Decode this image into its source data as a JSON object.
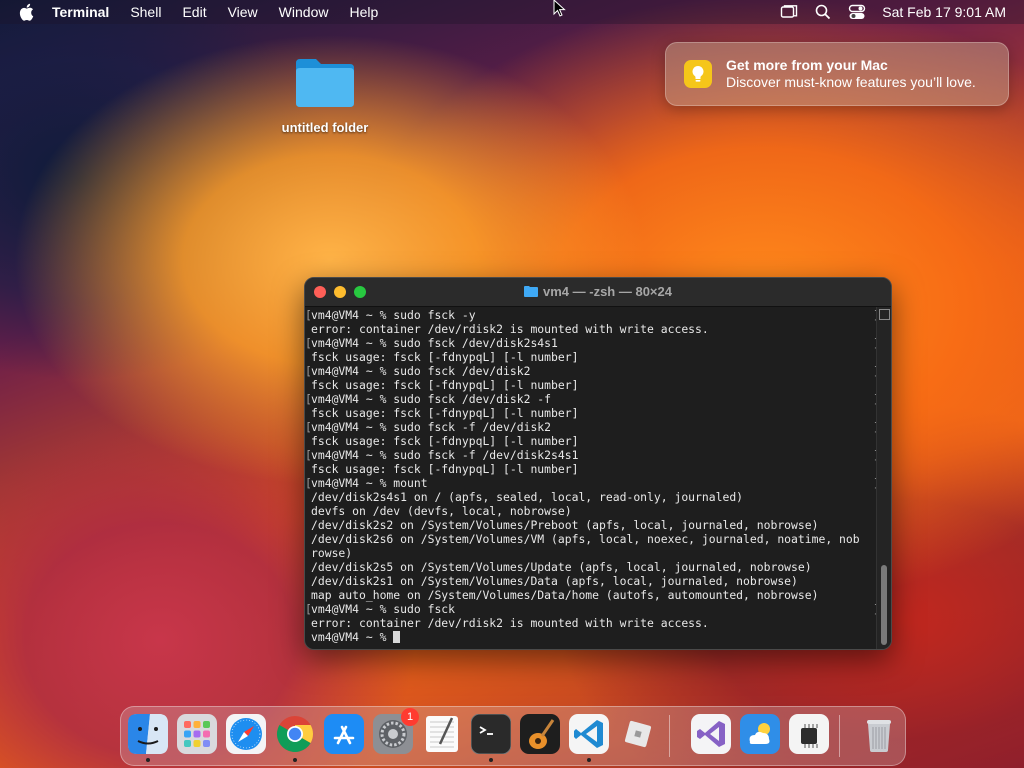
{
  "menubar": {
    "app_name": "Terminal",
    "menus": [
      "Shell",
      "Edit",
      "View",
      "Window",
      "Help"
    ],
    "clock": "Sat Feb 17  9:01 AM",
    "icons": [
      "apple-icon",
      "screen-mirroring-icon",
      "spotlight-search-icon",
      "control-center-icon"
    ]
  },
  "notification": {
    "title": "Get more from your Mac",
    "body": "Discover must-know features you’ll love.",
    "icon": "lightbulb-icon",
    "icon_color": "#f5c61a"
  },
  "desktop": {
    "folder_label": "untitled folder"
  },
  "terminal": {
    "title": "vm4 — -zsh — 80×24",
    "lines": [
      {
        "text": "vm4@VM4 ~ % sudo fsck -y",
        "prompt": true
      },
      {
        "text": "error: container /dev/rdisk2 is mounted with write access.",
        "prompt": false
      },
      {
        "text": "vm4@VM4 ~ % sudo fsck /dev/disk2s4s1",
        "prompt": true
      },
      {
        "text": "fsck usage: fsck [-fdnypqL] [-l number]",
        "prompt": false
      },
      {
        "text": "vm4@VM4 ~ % sudo fsck /dev/disk2",
        "prompt": true
      },
      {
        "text": "fsck usage: fsck [-fdnypqL] [-l number]",
        "prompt": false
      },
      {
        "text": "vm4@VM4 ~ % sudo fsck /dev/disk2 -f",
        "prompt": true
      },
      {
        "text": "fsck usage: fsck [-fdnypqL] [-l number]",
        "prompt": false
      },
      {
        "text": "vm4@VM4 ~ % sudo fsck -f /dev/disk2",
        "prompt": true
      },
      {
        "text": "fsck usage: fsck [-fdnypqL] [-l number]",
        "prompt": false
      },
      {
        "text": "vm4@VM4 ~ % sudo fsck -f /dev/disk2s4s1",
        "prompt": true
      },
      {
        "text": "fsck usage: fsck [-fdnypqL] [-l number]",
        "prompt": false
      },
      {
        "text": "vm4@VM4 ~ % mount",
        "prompt": true
      },
      {
        "text": "/dev/disk2s4s1 on / (apfs, sealed, local, read-only, journaled)",
        "prompt": false
      },
      {
        "text": "devfs on /dev (devfs, local, nobrowse)",
        "prompt": false
      },
      {
        "text": "/dev/disk2s2 on /System/Volumes/Preboot (apfs, local, journaled, nobrowse)",
        "prompt": false
      },
      {
        "text": "/dev/disk2s6 on /System/Volumes/VM (apfs, local, noexec, journaled, noatime, nob",
        "prompt": false
      },
      {
        "text": "rowse)",
        "prompt": false
      },
      {
        "text": "/dev/disk2s5 on /System/Volumes/Update (apfs, local, journaled, nobrowse)",
        "prompt": false
      },
      {
        "text": "/dev/disk2s1 on /System/Volumes/Data (apfs, local, journaled, nobrowse)",
        "prompt": false
      },
      {
        "text": "map auto_home on /System/Volumes/Data/home (autofs, automounted, nobrowse)",
        "prompt": false
      },
      {
        "text": "vm4@VM4 ~ % sudo fsck",
        "prompt": true
      },
      {
        "text": "error: container /dev/rdisk2 is mounted with write access.",
        "prompt": false
      },
      {
        "text": "vm4@VM4 ~ % ",
        "prompt": false
      }
    ]
  },
  "dock": {
    "apps": [
      {
        "name": "finder-icon",
        "running": true
      },
      {
        "name": "launchpad-icon",
        "running": false
      },
      {
        "name": "safari-icon",
        "running": false
      },
      {
        "name": "chrome-icon",
        "running": true
      },
      {
        "name": "app-store-icon",
        "running": false
      },
      {
        "name": "system-settings-icon",
        "running": false,
        "badge": "1"
      },
      {
        "name": "textedit-icon",
        "running": false
      },
      {
        "name": "terminal-icon",
        "running": true
      },
      {
        "name": "garageband-icon",
        "running": false
      },
      {
        "name": "vscode-icon",
        "running": true
      },
      {
        "name": "roblox-icon",
        "running": false
      },
      {
        "name": "visual-studio-icon",
        "running": false
      },
      {
        "name": "weather-icon",
        "running": false
      },
      {
        "name": "system-information-icon",
        "running": false
      },
      {
        "name": "trash-icon",
        "running": false
      }
    ],
    "badge_color": "#ff3b30"
  }
}
